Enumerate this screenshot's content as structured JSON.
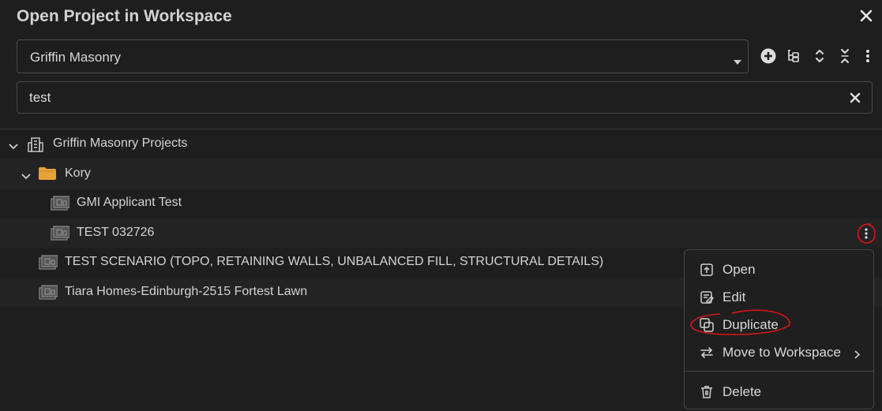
{
  "dialog": {
    "title": "Open Project in Workspace"
  },
  "workspace_select": {
    "value": "Griffin Masonry"
  },
  "toolbar": {
    "icons": [
      "add-circle-icon",
      "tree-view-icon",
      "expand-all-icon",
      "collapse-all-icon",
      "more-vertical-icon"
    ]
  },
  "search": {
    "value": "test"
  },
  "tree": {
    "root": {
      "label": "Griffin Masonry Projects",
      "icon": "building-icon",
      "expanded": true
    },
    "folder": {
      "label": "Kory",
      "icon": "folder-icon",
      "expanded": true,
      "color": "#e8a33b"
    },
    "items": [
      {
        "label": "GMI Applicant Test"
      },
      {
        "label": "TEST 032726"
      },
      {
        "label": "TEST SCENARIO (TOPO, RETAINING WALLS, UNBALANCED FILL, STRUCTURAL DETAILS)"
      },
      {
        "label": "Tiara Homes-Edinburgh-2515 Fortest Lawn"
      }
    ]
  },
  "context_menu": {
    "items": [
      {
        "label": "Open",
        "icon": "open-icon"
      },
      {
        "label": "Edit",
        "icon": "edit-icon"
      },
      {
        "label": "Duplicate",
        "icon": "duplicate-icon"
      },
      {
        "label": "Move to Workspace",
        "icon": "move-icon",
        "submenu": true
      },
      {
        "label": "Delete",
        "icon": "trash-icon"
      }
    ]
  },
  "annotation_color": "#d9141b"
}
